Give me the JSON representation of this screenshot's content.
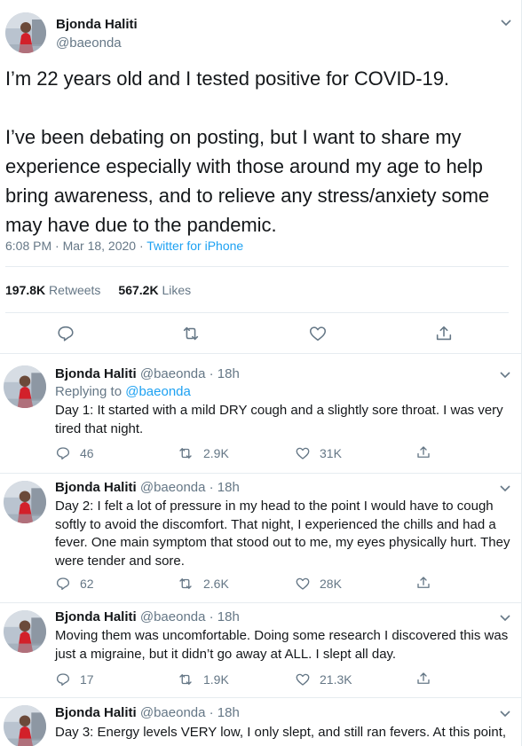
{
  "main_tweet": {
    "author_name": "Bjonda Haliti",
    "author_handle": "@baeonda",
    "text": "I’m 22 years old and I tested positive for COVID-19.\n\nI’ve been debating on posting, but I want to share my experience especially with those around my age to help bring awareness, and to relieve any stress/anxiety some may have due to the pandemic.",
    "time": "6:08 PM · Mar 18, 2020 · ",
    "source": "Twitter for iPhone",
    "retweets_count": "197.8K",
    "retweets_label": "Retweets",
    "likes_count": "567.2K",
    "likes_label": "Likes"
  },
  "replies": [
    {
      "name": "Bjonda Haliti",
      "handle_time": "@baeonda · 18h",
      "replying_prefix": "Replying to ",
      "replying_handle": "@baeonda",
      "text": "Day 1: It started with a mild DRY cough and a slightly sore throat. I was very tired that night.",
      "replies": "46",
      "retweets": "2.9K",
      "likes": "31K"
    },
    {
      "name": "Bjonda Haliti",
      "handle_time": "@baeonda · 18h",
      "text": "Day 2: I felt a lot of pressure in my head to the point I would have to cough softly to avoid the discomfort. That night, I experienced the chills and had a fever. One main symptom that stood out to me, my eyes physically hurt. They were tender and sore.",
      "replies": "62",
      "retweets": "2.6K",
      "likes": "28K"
    },
    {
      "name": "Bjonda Haliti",
      "handle_time": "@baeonda · 18h",
      "text": "Moving them was uncomfortable. Doing some research I discovered this was just a migraine, but it didn’t go away at ALL. I slept all day.",
      "replies": "17",
      "retweets": "1.9K",
      "likes": "21.3K"
    },
    {
      "name": "Bjonda Haliti",
      "handle_time": "@baeonda · 18h",
      "text": "Day 3: Energy levels VERY low, I only slept, and still ran fevers. At this point,"
    }
  ],
  "icons": {
    "reply": "reply-icon",
    "retweet": "retweet-icon",
    "like": "heart-icon",
    "share": "share-icon",
    "caret": "chevron-down-icon"
  },
  "colors": {
    "accent": "#1da1f2",
    "text": "#14171a",
    "muted": "#657786",
    "border": "#e6ecf0"
  }
}
